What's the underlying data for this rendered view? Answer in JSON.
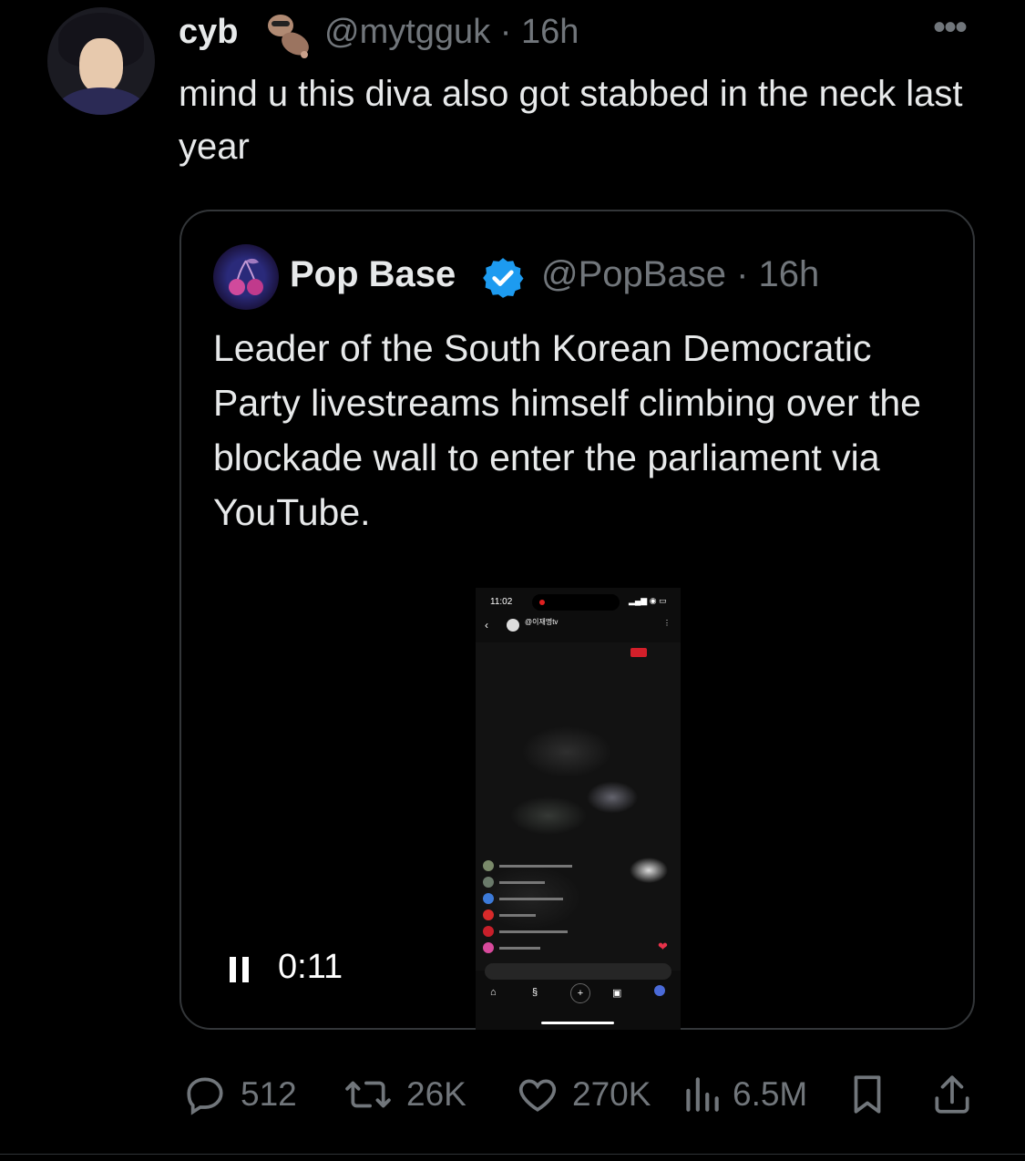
{
  "tweet": {
    "author_name": "cyb",
    "author_emoji": "otter-emoji",
    "handle_time": "@mytgguk · 16h",
    "more_label": "•••",
    "text": "mind u this diva also got stabbed in the neck last year"
  },
  "quote": {
    "author_name": "Pop Base",
    "handle_time": "@PopBase · 16h",
    "verified_color": "#1d9bf0",
    "text": "Leader of the South Korean Democratic Party livestreams himself climbing over the blockade wall to enter the parliament via YouTube.",
    "video": {
      "time": "0:11",
      "phone_clock": "11:02",
      "channel": "@이재명tv",
      "state": "playing"
    }
  },
  "actions": {
    "replies": "512",
    "reposts": "26K",
    "likes": "270K",
    "views": "6.5M"
  }
}
